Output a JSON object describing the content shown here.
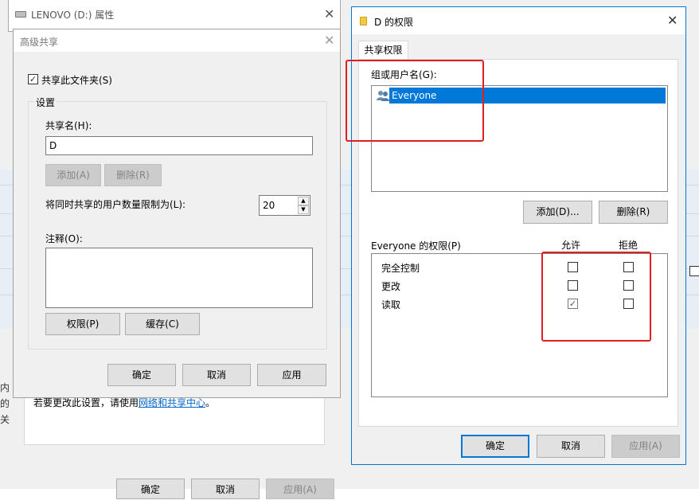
{
  "bg": {
    "frag_a": "内",
    "frag_b": "的",
    "frag_c": "关",
    "info_text": "若要更改此设置，请使用",
    "info_link": "网络和共享中心",
    "info_end": "。",
    "btn_ok": "确定",
    "btn_cancel": "取消",
    "btn_apply": "应用(A)"
  },
  "props": {
    "title": "LENOVO (D:) 属性"
  },
  "adv": {
    "title": "高级共享",
    "share_checkbox": "共享此文件夹(S)",
    "settings_group": "设置",
    "share_name_label": "共享名(H):",
    "share_name_value": "D",
    "add_button": "添加(A)",
    "remove_button": "删除(R)",
    "limit_label": "将同时共享的用户数量限制为(L):",
    "limit_value": "20",
    "comment_label": "注释(O):",
    "comment_value": "",
    "permissions_button": "权限(P)",
    "caching_button": "缓存(C)",
    "ok_button": "确定",
    "cancel_button": "取消",
    "apply_button": "应用"
  },
  "perm": {
    "title": "D 的权限",
    "tab_label": "共享权限",
    "group_label": "组或用户名(G):",
    "users": [
      "Everyone"
    ],
    "add_button": "添加(D)...",
    "remove_button": "删除(R)",
    "perm_label": "Everyone 的权限(P)",
    "allow_header": "允许",
    "deny_header": "拒绝",
    "rows": [
      {
        "name": "完全控制",
        "allow": false,
        "deny": false
      },
      {
        "name": "更改",
        "allow": false,
        "deny": false
      },
      {
        "name": "读取",
        "allow": true,
        "deny": false
      }
    ],
    "ok_button": "确定",
    "cancel_button": "取消",
    "apply_button": "应用(A)"
  },
  "colors": {
    "accent": "#0078d7",
    "highlight_box": "#e02020",
    "link": "#0066cc"
  }
}
